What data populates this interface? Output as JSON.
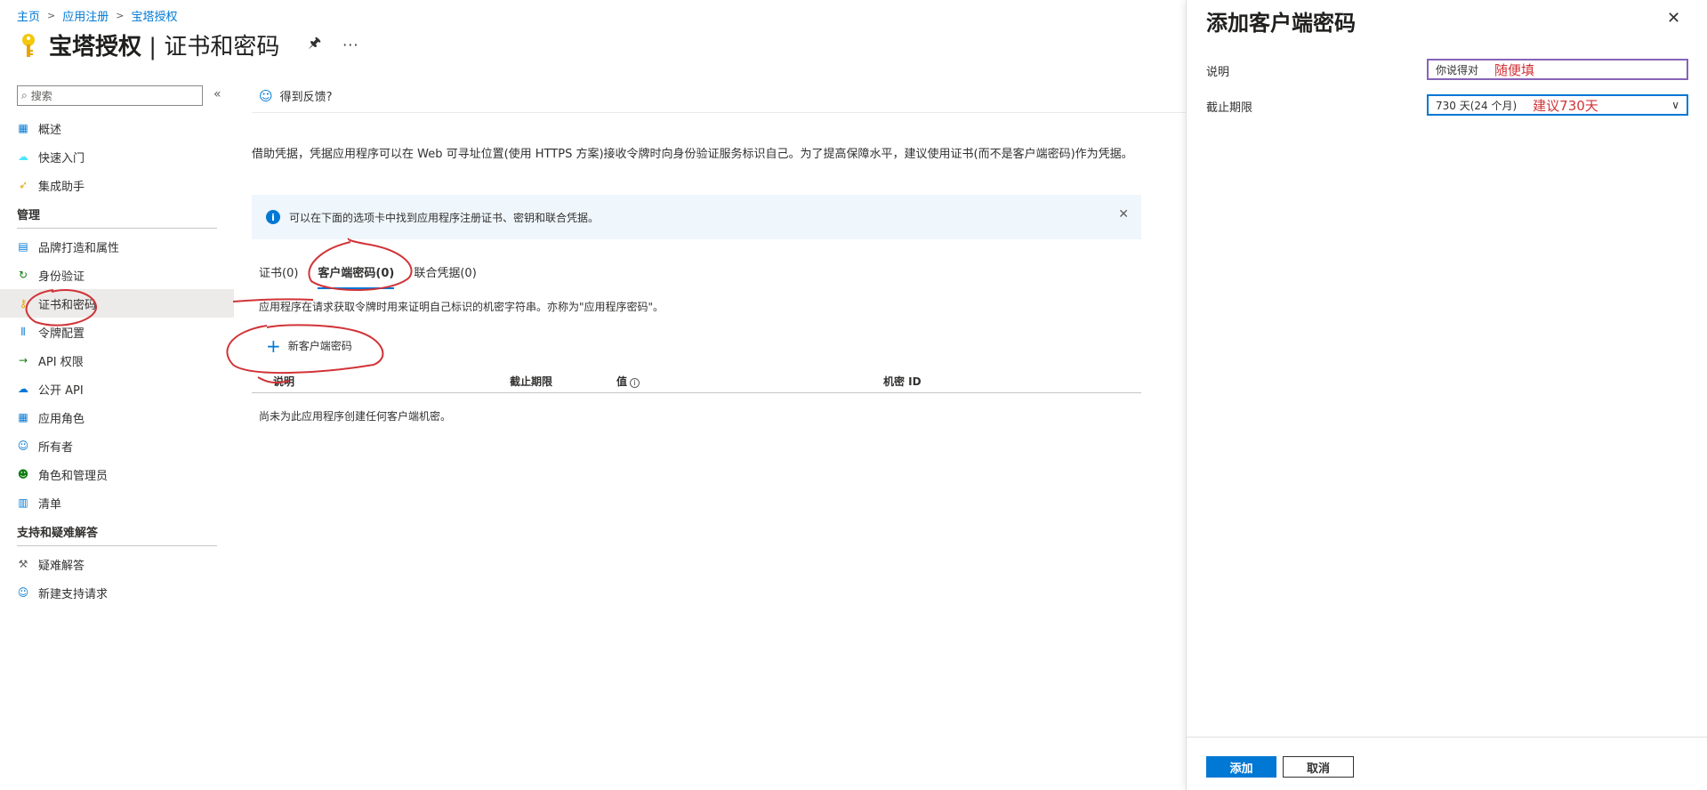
{
  "breadcrumb": {
    "home": "主页",
    "app_reg": "应用注册",
    "app": "宝塔授权"
  },
  "page": {
    "title": "宝塔授权",
    "subtitle": "证书和密码",
    "pin_icon": "pin-icon",
    "more_label": "···"
  },
  "sidebar": {
    "search_placeholder": "搜索",
    "collapse_label": "«",
    "top_items": [
      {
        "label": "概述",
        "icon": "overview-icon"
      },
      {
        "label": "快速入门",
        "icon": "quickstart-icon"
      },
      {
        "label": "集成助手",
        "icon": "rocket-icon"
      }
    ],
    "manage_header": "管理",
    "manage_items": [
      {
        "label": "品牌打造和属性",
        "icon": "branding-icon"
      },
      {
        "label": "身份验证",
        "icon": "auth-icon"
      },
      {
        "label": "证书和密码",
        "icon": "key-icon",
        "active": true
      },
      {
        "label": "令牌配置",
        "icon": "token-icon"
      },
      {
        "label": "API 权限",
        "icon": "api-permission-icon"
      },
      {
        "label": "公开 API",
        "icon": "cloud-icon"
      },
      {
        "label": "应用角色",
        "icon": "app-roles-icon"
      },
      {
        "label": "所有者",
        "icon": "owners-icon"
      },
      {
        "label": "角色和管理员",
        "icon": "roles-admins-icon"
      },
      {
        "label": "清单",
        "icon": "manifest-icon"
      }
    ],
    "support_header": "支持和疑难解答",
    "support_items": [
      {
        "label": "疑难解答",
        "icon": "wrench-icon"
      },
      {
        "label": "新建支持请求",
        "icon": "support-person-icon"
      }
    ]
  },
  "main": {
    "feedback": "得到反馈?",
    "description": "借助凭据，凭据应用程序可以在 Web 可寻址位置(使用 HTTPS 方案)接收令牌时向身份验证服务标识自己。为了提高保障水平，建议使用证书(而不是客户端密码)作为凭据。",
    "info_bar": "可以在下面的选项卡中找到应用程序注册证书、密钥和联合凭据。",
    "tabs": [
      {
        "label": "证书(0)"
      },
      {
        "label": "客户端密码(0)",
        "active": true
      },
      {
        "label": "联合凭据(0)"
      }
    ],
    "tab_description": "应用程序在请求获取令牌时用来证明自己标识的机密字符串。亦称为\"应用程序密码\"。",
    "new_secret_label": "新客户端密码",
    "columns": [
      "说明",
      "截止期限",
      "值",
      "机密 ID"
    ],
    "empty_message": "尚未为此应用程序创建任何客户端机密。"
  },
  "panel": {
    "title": "添加客户端密码",
    "description_label": "说明",
    "description_value": "你说得对",
    "description_annotation": "随便填",
    "expiry_label": "截止期限",
    "expiry_value": "730 天(24 个月)",
    "expiry_annotation": "建议730天",
    "add_label": "添加",
    "cancel_label": "取消"
  },
  "colors": {
    "accent": "#0078d4",
    "annotation": "#d13438",
    "info_bg": "#eff6fc"
  }
}
